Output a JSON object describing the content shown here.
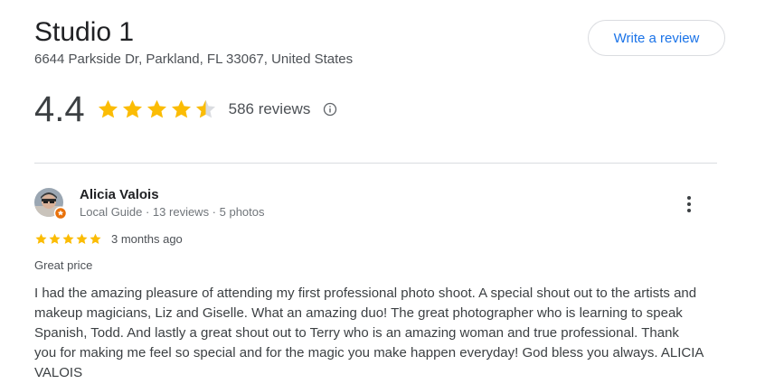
{
  "place": {
    "name": "Studio 1",
    "address": "6644 Parkside Dr, Parkland, FL 33067, United States"
  },
  "actions": {
    "write_review_label": "Write a review"
  },
  "rating": {
    "value": "4.4",
    "stars_out_of_5": 4.4,
    "review_count": "586 reviews",
    "star_color": "#fbbc04",
    "empty_star_color": "#dadce0"
  },
  "review": {
    "reviewer_name": "Alicia Valois",
    "reviewer_meta": "Local Guide · 13 reviews · 5 photos",
    "stars": 5,
    "time": "3 months ago",
    "tag": "Great price",
    "text": "I had the amazing pleasure of attending my first professional photo shoot. A special shout out to the artists and makeup magicians, Liz and Giselle. What an amazing duo! The great photographer who is learning to speak Spanish, Todd. And lastly a great shout out to Terry who is an amazing woman and true professional. Thank you for making me feel so special and for the magic you make happen everyday! God bless you always. ALICIA VALOIS"
  },
  "colors": {
    "accent": "#1a73e8",
    "local_guide_badge": "#e8710a"
  }
}
